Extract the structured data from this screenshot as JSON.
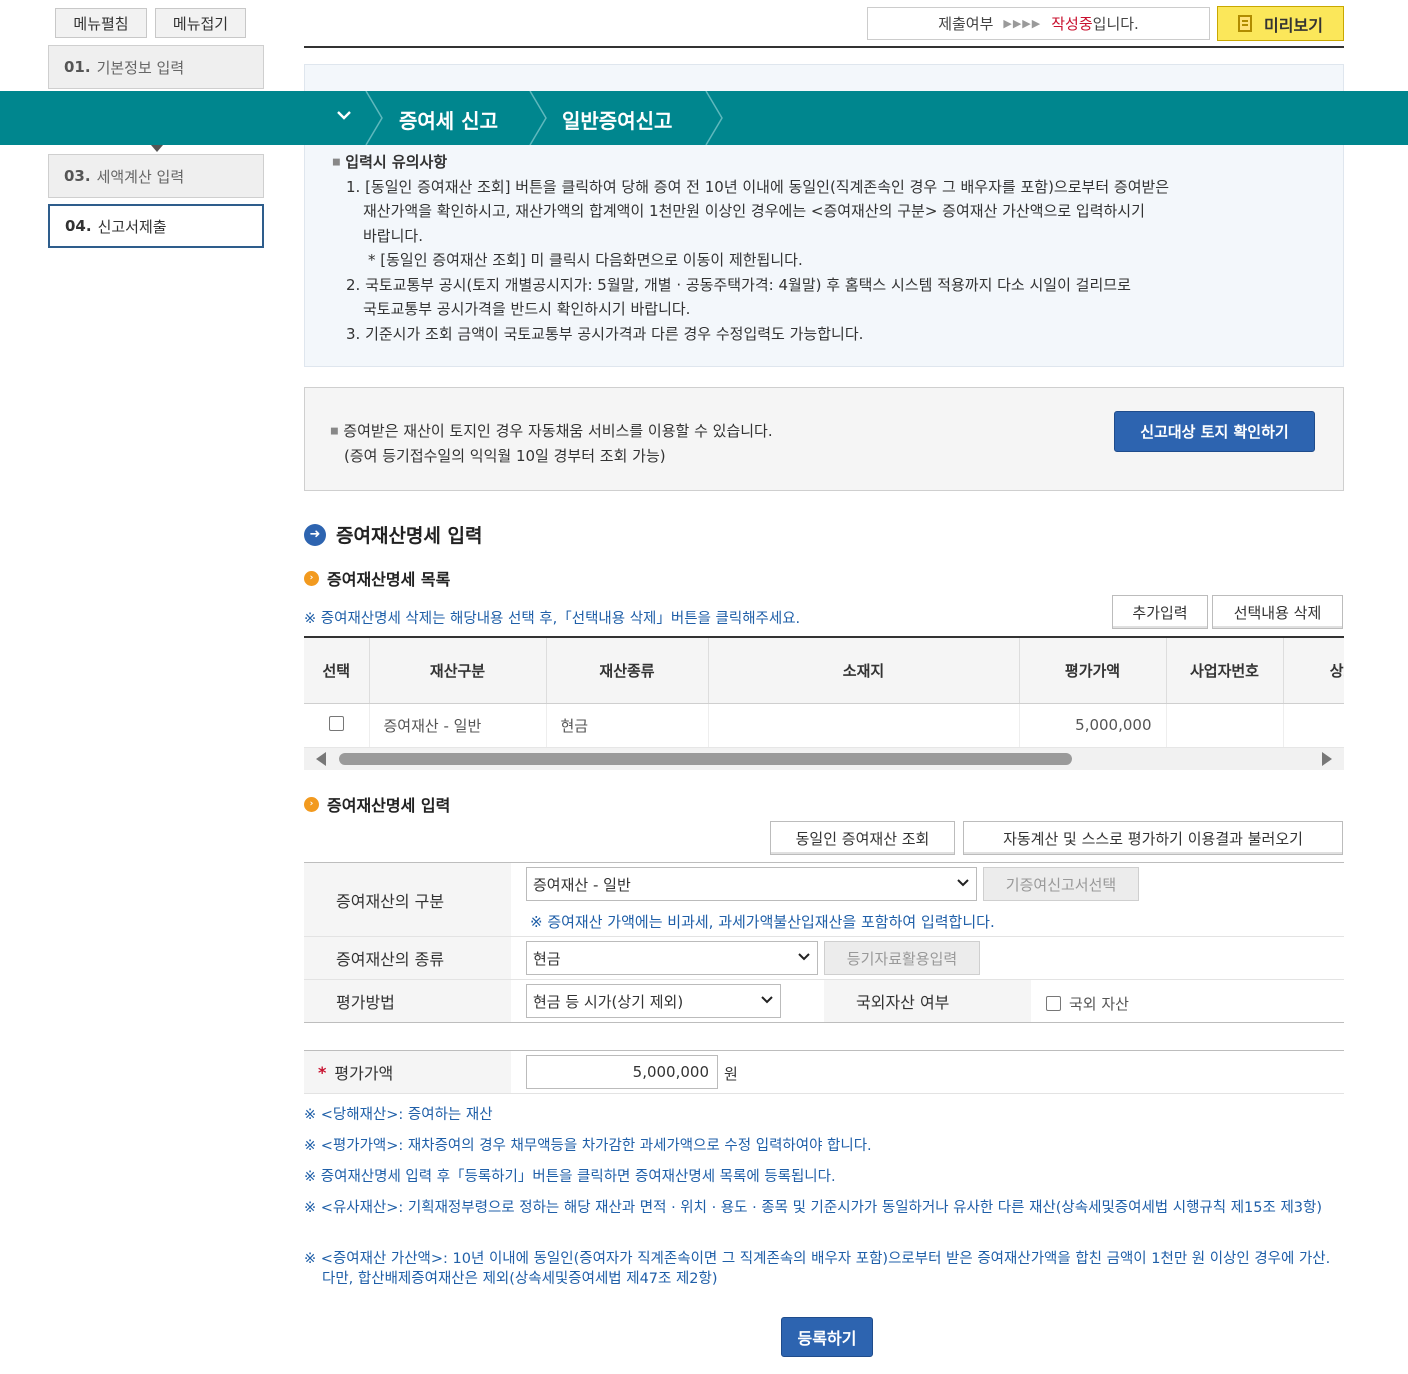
{
  "menu": {
    "expand_label": "메뉴펼침",
    "collapse_label": "메뉴접기"
  },
  "steps": [
    {
      "num": "01.",
      "label": "기본정보 입력"
    },
    {
      "num": "03.",
      "label": "세액계산 입력"
    },
    {
      "num": "04.",
      "label": "신고서제출"
    }
  ],
  "status": {
    "label": "제출여부",
    "state": "작성중",
    "suffix": "입니다.",
    "preview_label": "미리보기"
  },
  "breadcrumb": [
    "증여세 신고",
    "일반증여신고"
  ],
  "notice": {
    "title": "입력시 유의사항",
    "items": [
      "1. [동일인 증여재산 조회] 버튼을 클릭하여 당해 증여 전 10년 이내에 동일인(직계존속인 경우 그 배우자를 포함)으로부터 증여받은",
      "재산가액을 확인하시고, 재산가액의 합계액이 1천만원 이상인 경우에는 <증여재산의 구분> 증여재산 가산액으로 입력하시기",
      "바랍니다.",
      "* [동일인 증여재산 조회] 미 클릭시 다음화면으로 이동이 제한됩니다.",
      "2. 국토교통부 공시(토지 개별공시지가: 5월말, 개별 · 공동주택가격: 4월말) 후 홈택스 시스템 적용까지 다소 시일이 걸리므로",
      "국토교통부 공시가격을 반드시 확인하시기 바랍니다.",
      "3. 기준시가 조회 금액이 국토교통부 공시가격과 다른 경우 수정입력도 가능합니다."
    ]
  },
  "land": {
    "line1": "증여받은 재산이 토지인 경우 자동채움 서비스를 이용할 수 있습니다.",
    "line2": "(증여 등기접수일의 익익월 10일 경부터 조회 가능)",
    "button": "신고대상 토지 확인하기"
  },
  "section": {
    "title": "증여재산명세 입력",
    "list_title": "증여재산명세 목록",
    "list_note": "※ 증여재산명세 삭제는 해당내용 선택 후,「선택내용 삭제」버튼을 클릭해주세요.",
    "add_label": "추가입력",
    "delete_label": "선택내용 삭제",
    "input_title": "증여재산명세 입력",
    "same_person_label": "동일인 증여재산 조회",
    "auto_calc_label": "자동계산 및 스스로 평가하기 이용결과 불러오기"
  },
  "table": {
    "headers": [
      "선택",
      "재산구분",
      "재산종류",
      "소재지",
      "평가가액",
      "사업자번호",
      "상호"
    ],
    "rows": [
      {
        "category": "증여재산 - 일반",
        "kind": "현금",
        "location": "",
        "value": "5,000,000",
        "bizno": "",
        "name": ""
      }
    ]
  },
  "form": {
    "category_label": "증여재산의 구분",
    "category_value": "증여재산 - 일반",
    "prev_report_label": "기증여신고서선택",
    "category_note": "※ 증여재산 가액에는 비과세, 과세가액불산입재산을 포함하여 입력합니다.",
    "kind_label": "증여재산의 종류",
    "kind_value": "현금",
    "registry_label": "등기자료활용입력",
    "method_label": "평가방법",
    "method_value": "현금 등 시가(상기 제외)",
    "foreign_label": "국외자산 여부",
    "foreign_checkbox": "국외 자산",
    "value_label": "평가가액",
    "required_mark": "*",
    "value": "5,000,000",
    "unit": "원"
  },
  "footnotes": [
    "※ <당해재산>: 증여하는 재산",
    "※ <평가가액>: 재차증여의 경우 채무액등을 차가감한 과세가액으로 수정 입력하여야 합니다.",
    "※ 증여재산명세 입력 후「등록하기」버튼을 클릭하면 증여재산명세 목록에 등록됩니다.",
    "※ <유사재산>: 기획재정부령으로 정하는 해당 재산과 면적 · 위치 · 용도 · 종목 및 기준시가가 동일하거나 유사한 다른 재산(상속세및증여세법 시행규칙 제15조 제3항)",
    "※ <증여재산 가산액>: 10년 이내에 동일인(증여자가 직계존속이면 그 직계존속의 배우자 포함)으로부터 받은 증여재산가액을 합친 금액이 1천만 원 이상인 경우에 가산. 다만, 합산배제증여재산은 제외(상속세및증여세법 제47조 제2항)"
  ],
  "register_label": "등록하기",
  "colors": {
    "nav_teal": "#00868e",
    "primary_blue": "#2d64b0",
    "status_red": "#c8102e",
    "preview_yellow": "#fbe75a",
    "note_blue": "#1f5fa8"
  }
}
